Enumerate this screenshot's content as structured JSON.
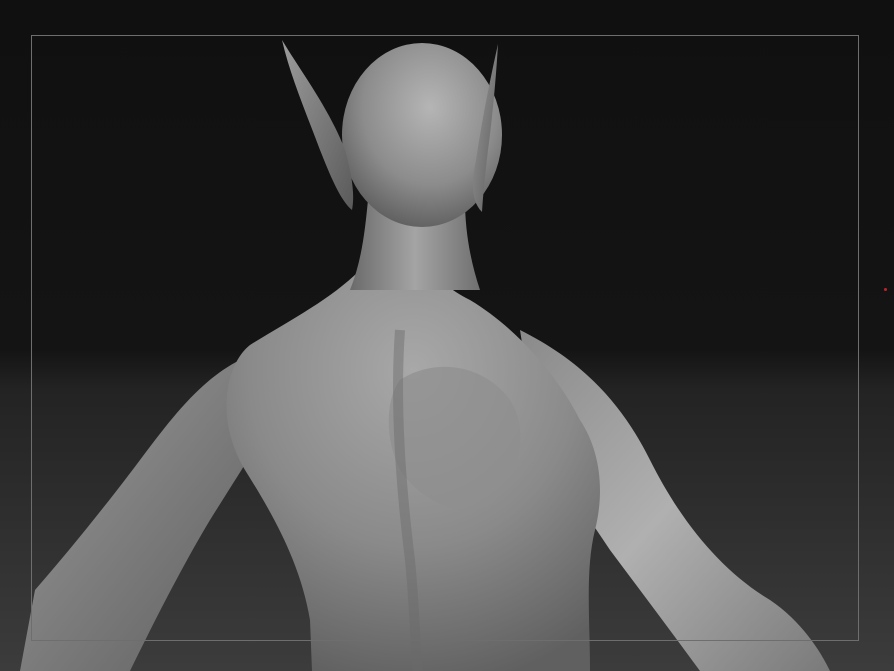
{
  "viewport": {
    "background_top": "#0f0f0f",
    "background_bottom": "#3a3a3a",
    "frame_color": "#6e6e6e",
    "marker_color": "#c0232a"
  },
  "model": {
    "material_light": "#b8b8b8",
    "material_mid": "#8a8a8a",
    "material_dark": "#4a4a4a"
  }
}
